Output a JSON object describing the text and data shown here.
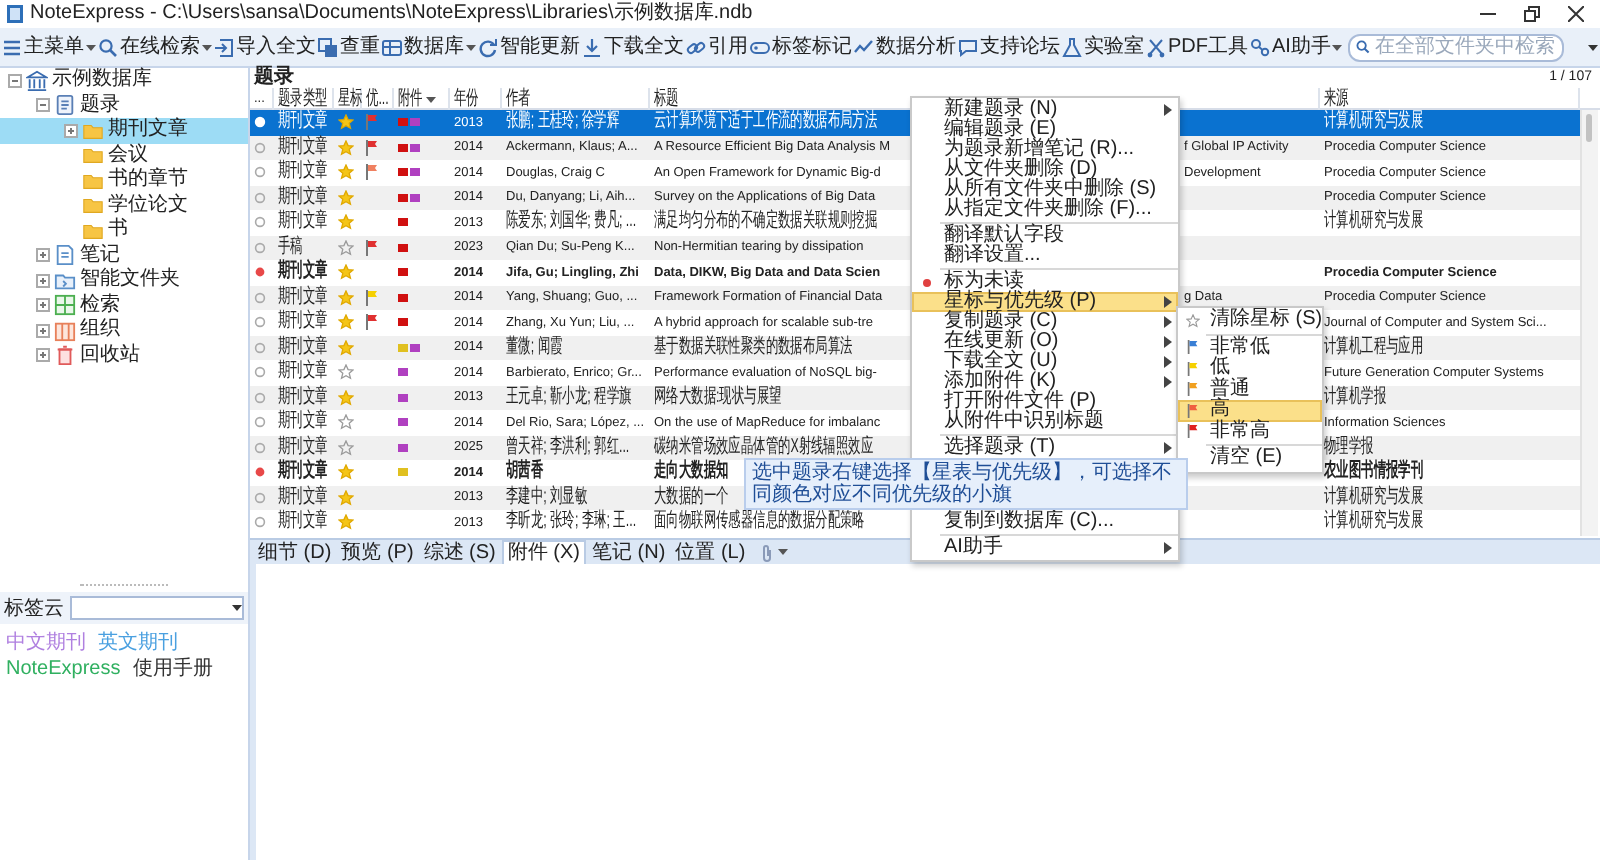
{
  "window": {
    "title": "NoteExpress - C:\\Users\\sansa\\Documents\\NoteExpress\\Libraries\\示例数据库.ndb"
  },
  "toolbar": {
    "items": [
      {
        "label": "主菜单",
        "dropdown": true
      },
      {
        "label": "在线检索",
        "dropdown": true
      },
      {
        "label": "导入全文",
        "dropdown": false
      },
      {
        "label": "查重",
        "dropdown": false
      },
      {
        "label": "数据库",
        "dropdown": true
      },
      {
        "label": "智能更新",
        "dropdown": false
      },
      {
        "label": "下载全文",
        "dropdown": false
      },
      {
        "label": "引用",
        "dropdown": false
      },
      {
        "label": "标签标记",
        "dropdown": false
      },
      {
        "label": "数据分析",
        "dropdown": false
      },
      {
        "label": "支持论坛",
        "dropdown": false
      },
      {
        "label": "实验室",
        "dropdown": false
      },
      {
        "label": "PDF工具",
        "dropdown": false
      },
      {
        "label": "AI助手",
        "dropdown": true
      }
    ],
    "search": {
      "placeholder": "在全部文件夹中检索"
    }
  },
  "tree": [
    {
      "label": "示例数据库",
      "kind": "database",
      "expanded": true,
      "selected": false,
      "children": [
        {
          "label": "题录",
          "kind": "records",
          "expanded": true,
          "selected": false,
          "children": [
            {
              "label": "期刊文章",
              "kind": "folder",
              "expanded": false,
              "selected": true
            },
            {
              "label": "会议",
              "kind": "folder",
              "selected": false
            },
            {
              "label": "书的章节",
              "kind": "folder",
              "selected": false
            },
            {
              "label": "学位论文",
              "kind": "folder",
              "selected": false
            },
            {
              "label": "书",
              "kind": "folder",
              "selected": false
            }
          ]
        },
        {
          "label": "笔记",
          "kind": "notes",
          "expanded": false,
          "selected": false
        },
        {
          "label": "智能文件夹",
          "kind": "smart",
          "expanded": false,
          "selected": false
        },
        {
          "label": "检索",
          "kind": "search",
          "expanded": false,
          "selected": false
        },
        {
          "label": "组织",
          "kind": "organize",
          "expanded": false,
          "selected": false
        },
        {
          "label": "回收站",
          "kind": "trash",
          "expanded": false,
          "selected": false
        }
      ]
    }
  ],
  "list_header": {
    "title": "题录",
    "count": "1 / 107"
  },
  "columns": [
    {
      "label": "...",
      "dropdown": false
    },
    {
      "label": "题录类型",
      "dropdown": false
    },
    {
      "label": "星标",
      "dropdown": false
    },
    {
      "label": "优...",
      "dropdown": false
    },
    {
      "label": "附件",
      "dropdown": true
    },
    {
      "label": "年份",
      "dropdown": false
    },
    {
      "label": "作者",
      "dropdown": false
    },
    {
      "label": "标题",
      "dropdown": false
    },
    {
      "label": "来源",
      "dropdown": false
    }
  ],
  "rows": [
    {
      "selected": true,
      "unread": false,
      "type": "期刊文章",
      "starred": true,
      "flag": {
        "color": "#e03030"
      },
      "attachments": [
        {
          "color": "#d01010"
        },
        {
          "color": "#b040c0"
        }
      ],
      "year": "2013",
      "author": "张鹏; 王桂玲; 徐学辉",
      "title": "云计算环境下适于工作流的数据布局方法",
      "source": "计算机研究与发展"
    },
    {
      "selected": false,
      "unread": false,
      "type": "期刊文章",
      "starred": true,
      "flag": {
        "color": "#e03030"
      },
      "attachments": [
        {
          "color": "#d01010"
        },
        {
          "color": "#b040c0"
        }
      ],
      "year": "2014",
      "author": "Ackermann, Klaus; A...",
      "title": "A Resource Efficient Big Data Analysis M",
      "title_tail": "f Global IP Activity",
      "source": "Procedia Computer Science"
    },
    {
      "selected": false,
      "unread": false,
      "type": "期刊文章",
      "starred": true,
      "flag": {
        "color": "#f08060"
      },
      "attachments": [
        {
          "color": "#d01010"
        },
        {
          "color": "#b040c0"
        }
      ],
      "year": "2014",
      "author": "Douglas, Craig C",
      "title": "An Open Framework for Dynamic Big-d",
      "title_tail": "Development",
      "source": "Procedia Computer Science"
    },
    {
      "selected": false,
      "unread": false,
      "type": "期刊文章",
      "starred": true,
      "attachments": [
        {
          "color": "#d01010"
        },
        {
          "color": "#b040c0"
        }
      ],
      "year": "2014",
      "author": "Du, Danyang; Li, Aih...",
      "title": "Survey on the Applications of Big Data",
      "source": "Procedia Computer Science"
    },
    {
      "selected": false,
      "unread": false,
      "type": "期刊文章",
      "starred": true,
      "attachments": [
        {
          "color": "#d01010"
        }
      ],
      "year": "2013",
      "author": "陈爱东; 刘国华; 费凡; ...",
      "title": "满足均匀分布的不确定数据关联规则挖掘",
      "source": "计算机研究与发展"
    },
    {
      "selected": false,
      "unread": false,
      "type": "手稿",
      "starred": false,
      "flag": {
        "color": "#e03030"
      },
      "attachments": [
        {
          "color": "#d01010"
        }
      ],
      "year": "2023",
      "author": "Qian Du; Su-Peng K...",
      "title": "Non-Hermitian tearing by dissipation"
    },
    {
      "selected": false,
      "unread": true,
      "type": "期刊文章",
      "starred": true,
      "attachments": [
        {
          "color": "#d01010"
        }
      ],
      "year": "2014",
      "author": "Jifa, Gu; Lingling, Zhi",
      "title": "Data, DIKW, Big Data and Data Scien",
      "source": "Procedia Computer Science"
    },
    {
      "selected": false,
      "unread": false,
      "type": "期刊文章",
      "starred": true,
      "flag": {
        "color": "#f5d000"
      },
      "attachments": [
        {
          "color": "#d01010"
        }
      ],
      "year": "2014",
      "author": "Yang, Shuang; Guo, ...",
      "title": "Framework Formation of Financial Data",
      "title_tail": "g Data",
      "source": "Procedia Computer Science"
    },
    {
      "selected": false,
      "unread": false,
      "type": "期刊文章",
      "starred": true,
      "flag": {
        "color": "#e03030"
      },
      "attachments": [
        {
          "color": "#d01010"
        }
      ],
      "year": "2014",
      "author": "Zhang, Xu Yun; Liu, ...",
      "title": "A hybrid approach for scalable sub-tre",
      "source": "Journal of Computer and System Sci..."
    },
    {
      "selected": false,
      "unread": false,
      "type": "期刊文章",
      "starred": true,
      "attachments": [
        {
          "color": "#e0c020"
        },
        {
          "color": "#b040c0"
        }
      ],
      "year": "2014",
      "author": "董微; 闻霞",
      "title": "基于数据关联性聚类的数据布局算法",
      "source": "计算机工程与应用"
    },
    {
      "selected": false,
      "unread": false,
      "type": "期刊文章",
      "starred": false,
      "attachments": [
        {
          "color": "#b040c0"
        }
      ],
      "year": "2014",
      "author": "Barbierato, Enrico; Gr...",
      "title": "Performance evaluation of NoSQL big-",
      "source": "Future Generation Computer Systems"
    },
    {
      "selected": false,
      "unread": false,
      "type": "期刊文章",
      "starred": true,
      "attachments": [
        {
          "color": "#b040c0"
        }
      ],
      "year": "2013",
      "author": "王元卓; 靳小龙; 程学旗",
      "title": "网络大数据:现状与展望",
      "source": "计算机学报"
    },
    {
      "selected": false,
      "unread": false,
      "type": "期刊文章",
      "starred": false,
      "attachments": [
        {
          "color": "#b040c0"
        }
      ],
      "year": "2014",
      "author": "Del Rio, Sara; López, ...",
      "title": "On the use of MapReduce for imbalanc",
      "source": "Information Sciences"
    },
    {
      "selected": false,
      "unread": false,
      "type": "期刊文章",
      "starred": false,
      "attachments": [
        {
          "color": "#b040c0"
        }
      ],
      "year": "2025",
      "author": "曾天祥; 李洪利; 郭红...",
      "title": "碳纳米管场效应晶体管的X射线辐照效应",
      "source": "物理学报"
    },
    {
      "selected": false,
      "unread": true,
      "type": "期刊文章",
      "starred": true,
      "attachments": [
        {
          "color": "#e0c020"
        }
      ],
      "year": "2014",
      "author": "胡茜香",
      "title": "走向大数据知",
      "source": "农业图书情报学刊"
    },
    {
      "selected": false,
      "unread": false,
      "type": "期刊文章",
      "starred": true,
      "attachments": [],
      "year": "2013",
      "author": "李建中; 刘显敏",
      "title": "大数据的一个",
      "source": "计算机研究与发展"
    },
    {
      "selected": false,
      "unread": false,
      "type": "期刊文章",
      "starred": true,
      "attachments": [],
      "year": "2013",
      "author": "李昕龙; 张玲; 李琳; 王...",
      "title": "面向物联网传感器信息的数据分配策略",
      "source": "计算机研究与发展"
    }
  ],
  "context_menu": {
    "items": [
      {
        "kind": "item",
        "label": "新建题录 (N)",
        "submenu": true,
        "selected": false
      },
      {
        "kind": "item",
        "label": "编辑题录 (E)",
        "submenu": false,
        "selected": false
      },
      {
        "kind": "item",
        "label": "为题录新增笔记 (R)...",
        "submenu": false,
        "selected": false
      },
      {
        "kind": "item",
        "label": "从文件夹删除 (D)",
        "submenu": false,
        "selected": false
      },
      {
        "kind": "item",
        "label": "从所有文件夹中删除 (S)",
        "submenu": false,
        "selected": false
      },
      {
        "kind": "item",
        "label": "从指定文件夹删除 (F)...",
        "submenu": false,
        "selected": false
      },
      {
        "kind": "separator"
      },
      {
        "kind": "item",
        "label": "翻译默认字段",
        "submenu": false,
        "selected": false
      },
      {
        "kind": "item",
        "label": "翻译设置...",
        "submenu": false,
        "selected": false
      },
      {
        "kind": "separator"
      },
      {
        "kind": "dot",
        "label": "标为未读",
        "submenu": false,
        "selected": false
      },
      {
        "kind": "item",
        "label": "星标与优先级 (P)",
        "submenu": true,
        "selected": true
      },
      {
        "kind": "item",
        "label": "复制题录 (C)",
        "submenu": true,
        "selected": false
      },
      {
        "kind": "item",
        "label": "在线更新 (O)",
        "submenu": true,
        "selected": false
      },
      {
        "kind": "item",
        "label": "下载全文 (U)",
        "submenu": true,
        "selected": false
      },
      {
        "kind": "item",
        "label": "添加附件 (K)",
        "submenu": true,
        "selected": false
      },
      {
        "kind": "item",
        "label": "打开附件文件 (P)",
        "submenu": false,
        "selected": false
      },
      {
        "kind": "item",
        "label": "从附件中识别标题",
        "submenu": false,
        "selected": false
      },
      {
        "kind": "separator"
      },
      {
        "kind": "item",
        "label": "选择题录 (T)",
        "submenu": true,
        "selected": false
      }
    ],
    "bottom_items": [
      {
        "kind": "item",
        "label": "复制到数据库 (C)...",
        "submenu": false,
        "selected": false
      },
      {
        "kind": "separator"
      },
      {
        "kind": "item",
        "label": "AI助手",
        "submenu": true,
        "selected": false
      }
    ]
  },
  "submenu": {
    "items": [
      {
        "kind": "star",
        "label": "清除星标 (S)",
        "selected": false
      },
      {
        "kind": "separator"
      },
      {
        "kind": "flag",
        "label": "非常低",
        "color": "#3a7fd5",
        "selected": false
      },
      {
        "kind": "flag",
        "label": "低",
        "color": "#f5d000",
        "selected": false
      },
      {
        "kind": "flag",
        "label": "普通",
        "color": "#f0a020",
        "selected": false
      },
      {
        "kind": "flag",
        "label": "高",
        "color": "#f06040",
        "selected": true
      },
      {
        "kind": "flag",
        "label": "非常高",
        "color": "#e02020",
        "selected": false
      },
      {
        "kind": "separator"
      },
      {
        "kind": "item",
        "label": "清空 (E)",
        "selected": false
      }
    ]
  },
  "tip": "选中题录右键选择【星表与优先级】，可选择不同颜色对应不同优先级的小旗",
  "bottom_tabs": [
    {
      "label": "细节 (D)",
      "selected": false
    },
    {
      "label": "预览 (P)",
      "selected": false
    },
    {
      "label": "综述 (S)",
      "selected": false
    },
    {
      "label": "附件 (X)",
      "selected": true
    },
    {
      "label": "笔记 (N)",
      "selected": false
    },
    {
      "label": "位置 (L)",
      "selected": false
    }
  ],
  "tag_cloud": {
    "label": "标签云",
    "tags": [
      {
        "label": "中文期刊",
        "color": "#b080e0"
      },
      {
        "label": "英文期刊",
        "color": "#4aa0e0"
      },
      {
        "label": "NoteExpress",
        "color": "#30b060"
      },
      {
        "label": "使用手册",
        "color": "#333333"
      }
    ]
  }
}
